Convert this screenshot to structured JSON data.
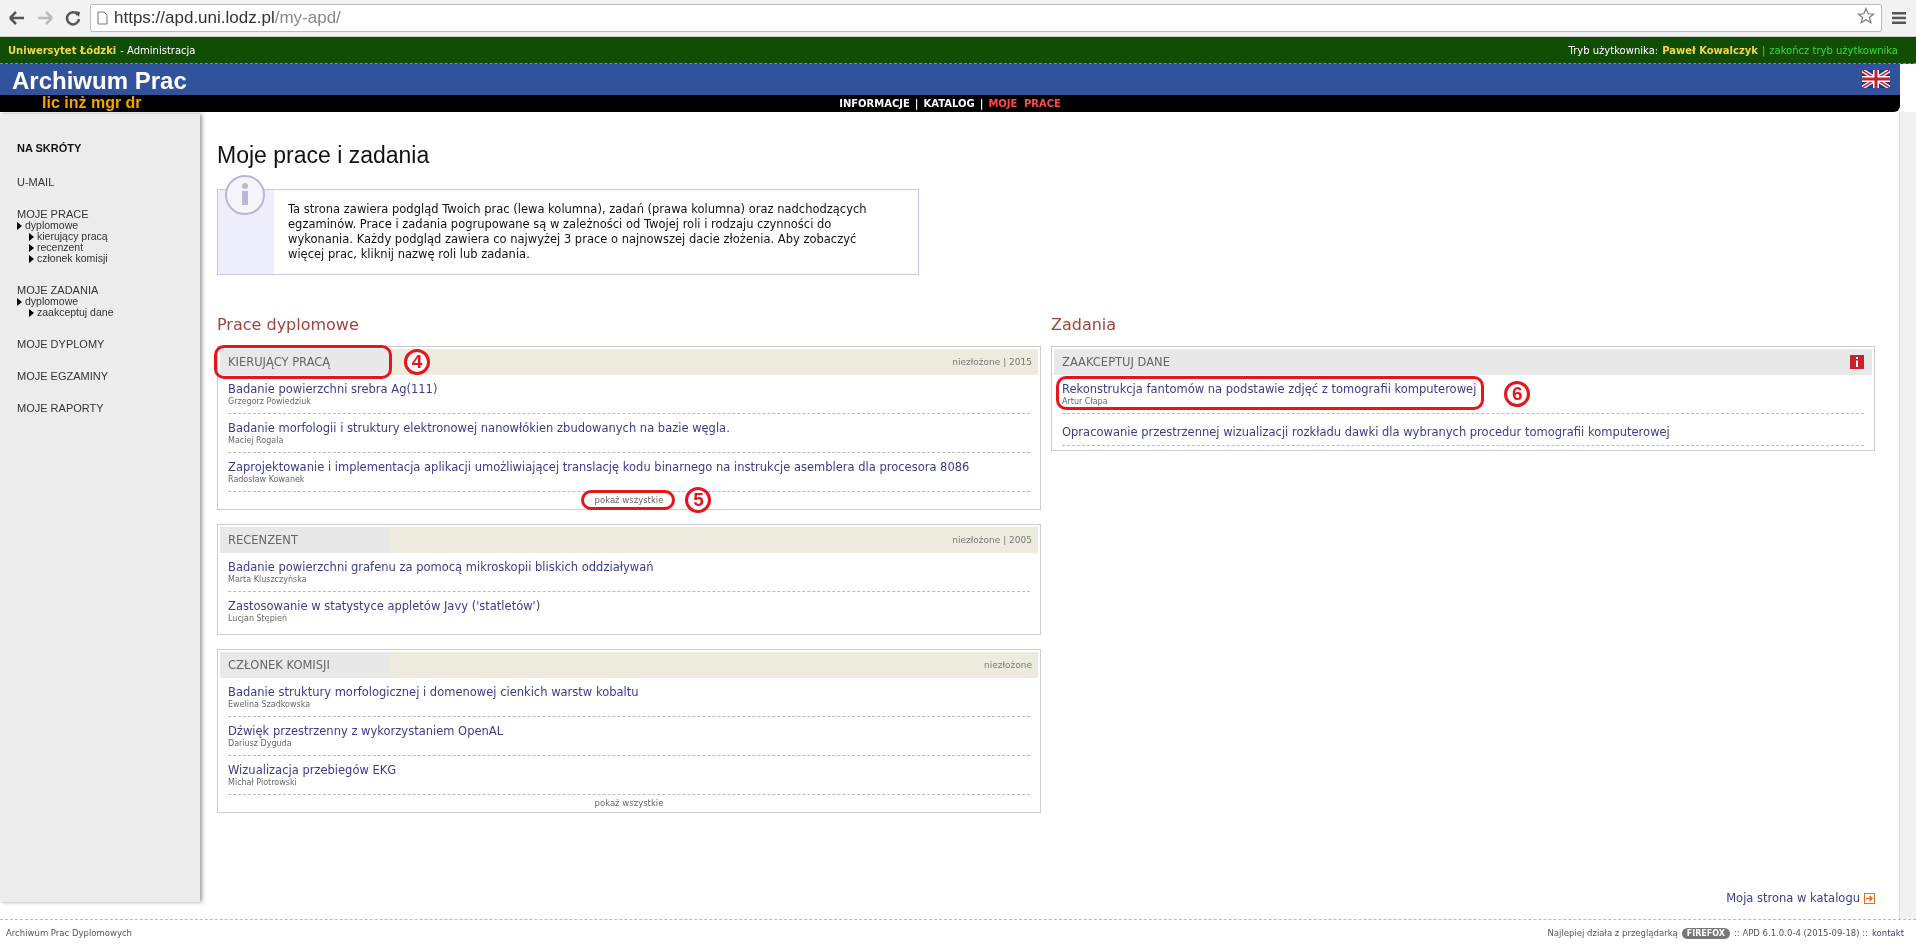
{
  "browser": {
    "url_host": "https://apd.uni.lodz.pl",
    "url_path": "/my-apd/"
  },
  "top_bar": {
    "university": "Uniwersytet Łódzki",
    "section": "- Administracja",
    "mode_label": "Tryb użytkownika:",
    "user": "Paweł Kowalczyk",
    "divider": "|",
    "end_mode": "zakończ tryb użytkownika"
  },
  "header": {
    "logo": "Archiwum Prac",
    "degrees": "lic inż mgr dr"
  },
  "nav": {
    "separator": "|",
    "items": [
      {
        "label": "INFORMACJE",
        "selected": false
      },
      {
        "label": "KATALOG",
        "selected": false
      },
      {
        "label": "MOJE PRACE",
        "selected": true
      }
    ]
  },
  "sidebar": {
    "heading": "NA SKRÓTY",
    "sections": [
      {
        "label": "U-MAIL"
      },
      {
        "label": "MOJE PRACE",
        "children": [
          {
            "label": "dyplomowe",
            "children": [
              {
                "label": "kierujący pracą"
              },
              {
                "label": "recenzent"
              },
              {
                "label": "członek komisji"
              }
            ]
          }
        ]
      },
      {
        "label": "MOJE ZADANIA",
        "children": [
          {
            "label": "dyplomowe",
            "children": [
              {
                "label": "zaakceptuj dane"
              }
            ]
          }
        ]
      },
      {
        "label": "MOJE DYPLOMY"
      },
      {
        "label": "MOJE EGZAMINY"
      },
      {
        "label": "MOJE RAPORTY"
      }
    ]
  },
  "page_title": "Moje prace i zadania",
  "info": "Ta strona zawiera podgląd Twoich prac (lewa kolumna), zadań (prawa kolumna) oraz nadchodzących egzaminów. Prace i zadania pogrupowane są w zależności od Twojej roli i rodzaju czynności do wykonania. Każdy podgląd zawiera co najwyżej 3 prace o najnowszej dacie złożenia. Aby zobaczyć więcej prac, kliknij nazwę roli lub zadania.",
  "left_column": {
    "title": "Prace dyplomowe",
    "panels": [
      {
        "title": "KIERUJĄCY PRACĄ",
        "meta": "niezłożone | 2015",
        "annotation": "4",
        "items": [
          {
            "title": "Badanie powierzchni srebra Ag(111)",
            "author": "Grzegorz Powiedziuk"
          },
          {
            "title": "Badanie morfologii i struktury elektronowej nanowłókien zbudowanych na bazie węgla.",
            "author": "Maciej Rogala"
          },
          {
            "title": "Zaprojektowanie i implementacja aplikacji umożliwiającej translację kodu binarnego na instrukcje asemblera dla procesora 8086",
            "author": "Radosław Kowanek"
          }
        ],
        "show_all": "pokaż wszystkie",
        "show_all_annotation": "5"
      },
      {
        "title": "RECENZENT",
        "meta": "niezłożone | 2005",
        "items": [
          {
            "title": "Badanie powierzchni grafenu za pomocą mikroskopii bliskich oddziaływań",
            "author": "Marta Kluszczyńska"
          },
          {
            "title": "Zastosowanie w statystyce appletów Javy ('statletów')",
            "author": "Lucjan Stępień"
          }
        ]
      },
      {
        "title": "CZŁONEK KOMISJI",
        "meta": "niezłożone",
        "items": [
          {
            "title": "Badanie struktury morfologicznej i domenowej cienkich warstw kobaltu",
            "author": "Ewelina Szadkowska"
          },
          {
            "title": "Dźwięk przestrzenny z wykorzystaniem OpenAL",
            "author": "Dariusz Dyguda"
          },
          {
            "title": "Wizualizacja przebiegów EKG",
            "author": "Michał Piotrowski"
          }
        ],
        "show_all": "pokaż wszystkie"
      }
    ]
  },
  "right_column": {
    "title": "Zadania",
    "panels": [
      {
        "title": "ZAAKCEPTUJ DANE",
        "items": [
          {
            "title": "Rekonstrukcja fantomów na podstawie zdjęć z tomografii komputerowej",
            "author": "Artur Cłapa",
            "annotation": "6"
          },
          {
            "title": "Opracowanie przestrzennej wizualizacji rozkładu dawki dla wybranych procedur tomografii komputerowej"
          }
        ]
      }
    ]
  },
  "catalog_link": "Moja strona w katalogu",
  "footer": {
    "left": "Archiwum Prac Dyplomowych",
    "works_best": "Najlepiej działa z przeglądarką",
    "browser_badge": "FIREFOX",
    "version": ":: APD 6.1.0.0-4 (2015-09-18) ::",
    "contact": "kontakt"
  }
}
